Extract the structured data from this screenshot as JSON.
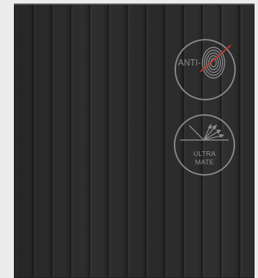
{
  "badges": {
    "anti_fingerprint": {
      "label": "ANTI-",
      "icon": "fingerprint-icon",
      "slash_color": "#c0392b",
      "ring_color": "#8a8a8a"
    },
    "ultra_matte": {
      "line1": "ULTRA",
      "line2": "MATE",
      "icon": "light-reflection-icon",
      "ring_color": "#8a8a8a"
    }
  }
}
